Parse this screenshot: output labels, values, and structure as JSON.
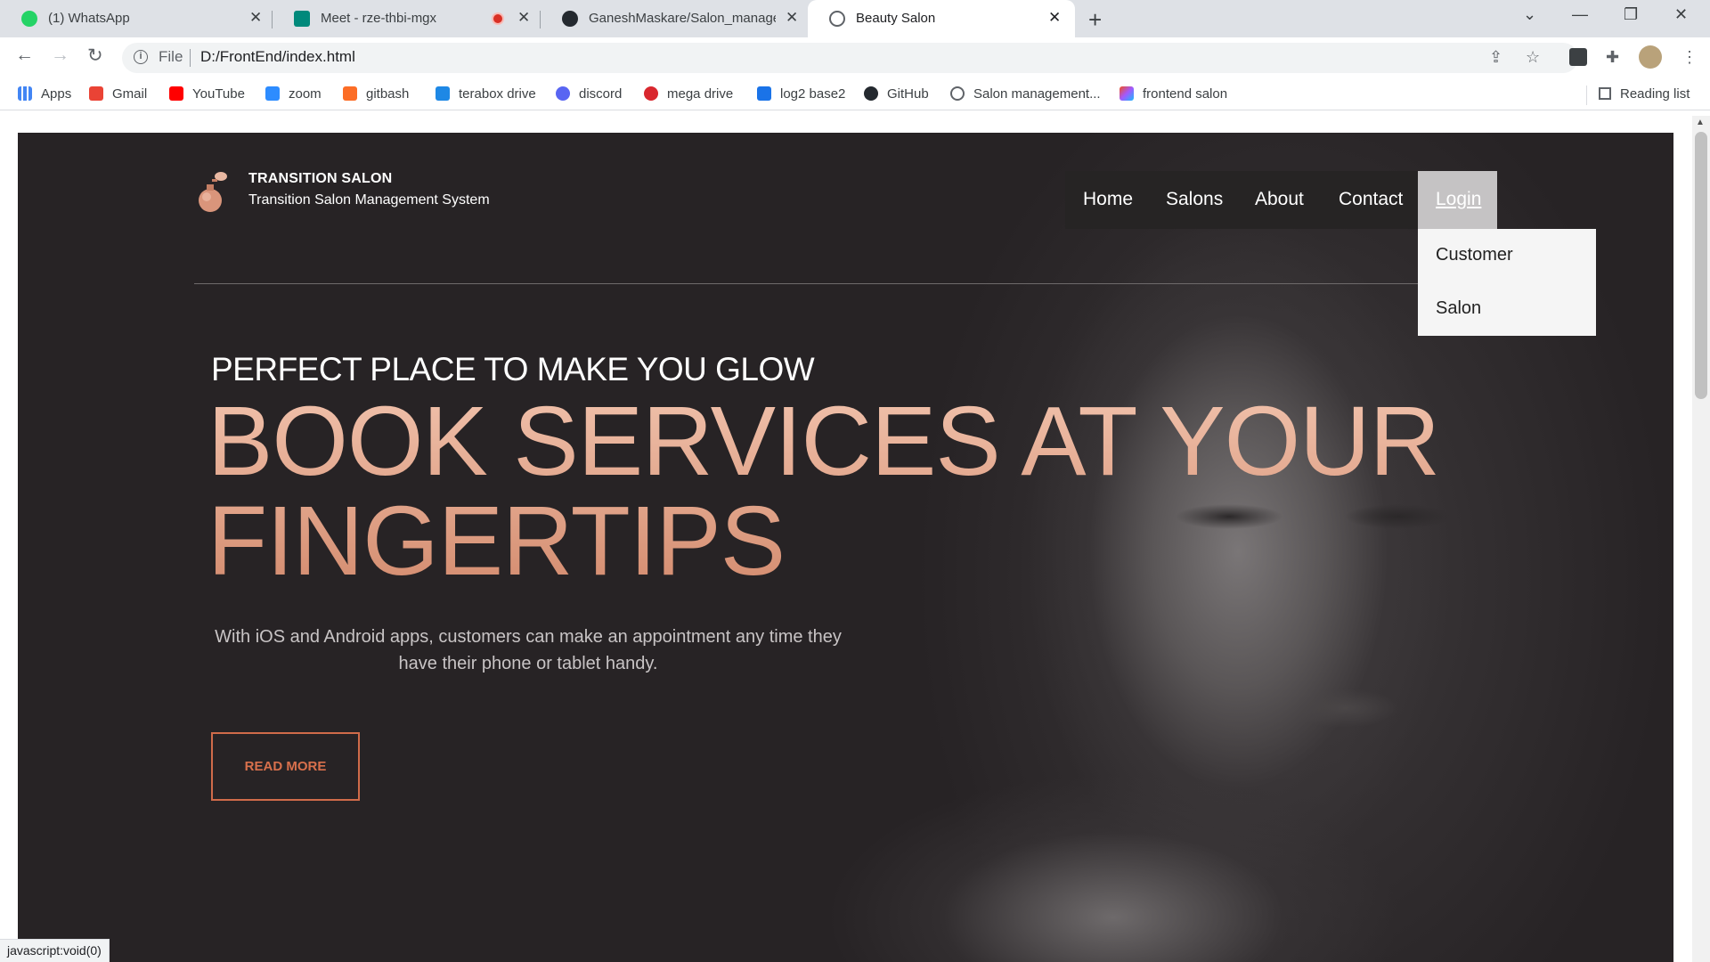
{
  "browser": {
    "tabs": [
      {
        "title": "(1) WhatsApp",
        "favicon_color": "#25d366",
        "badge": "1"
      },
      {
        "title": "Meet - rze-thbi-mgx",
        "favicon_color": "#00897b"
      },
      {
        "title": "GaneshMaskare/Salon_managem",
        "favicon_color": "#24292f"
      },
      {
        "title": "Beauty Salon",
        "favicon_color": "#5f6368"
      }
    ],
    "new_tab": "+",
    "close_glyph": "✕",
    "window_controls": [
      "⌄",
      "—",
      "❐",
      "✕"
    ],
    "address": {
      "scheme_label": "File",
      "url": "D:/FrontEnd/index.html"
    },
    "bookmarks": [
      {
        "label": "Apps",
        "icon": "apps-grid-icon",
        "color": "#4285f4"
      },
      {
        "label": "Gmail",
        "icon": "gmail-icon",
        "color": "#ea4335"
      },
      {
        "label": "YouTube",
        "icon": "youtube-icon",
        "color": "#ff0000"
      },
      {
        "label": "zoom",
        "icon": "zoom-icon",
        "color": "#2d8cff"
      },
      {
        "label": "gitbash",
        "icon": "gitlab-icon",
        "color": "#fc6d26"
      },
      {
        "label": "terabox drive",
        "icon": "terabox-icon",
        "color": "#1e88e5"
      },
      {
        "label": "discord",
        "icon": "discord-icon",
        "color": "#5865f2"
      },
      {
        "label": "mega drive",
        "icon": "mega-icon",
        "color": "#d9272e"
      },
      {
        "label": "log2 base2",
        "icon": "log-icon",
        "color": "#1a73e8"
      },
      {
        "label": "GitHub",
        "icon": "github-icon",
        "color": "#24292f"
      },
      {
        "label": "Salon management...",
        "icon": "globe-icon",
        "color": "#5f6368"
      },
      {
        "label": "frontend salon",
        "icon": "figma-icon",
        "color": "#a259ff"
      }
    ],
    "reading_list": "Reading list",
    "status_text": "javascript:void(0)"
  },
  "site": {
    "brand_title": "TRANSITION SALON",
    "brand_subtitle": "Transition Salon Management System",
    "nav": [
      "Home",
      "Salons",
      "About",
      "Contact"
    ],
    "login": "Login",
    "dropdown": [
      "Customer",
      "Salon"
    ],
    "tagline": "PERFECT PLACE TO MAKE YOU GLOW",
    "headline_line1": "BOOK SERVICES AT YOUR",
    "headline_line2": "FINGERTIPS",
    "description": "With iOS and Android apps, customers can make an appointment any time they have their phone or tablet handy.",
    "cta": "READ MORE",
    "colors": {
      "hero_bg": "#272325",
      "accent": "#d8704c",
      "headline": "#e8b39b"
    }
  }
}
